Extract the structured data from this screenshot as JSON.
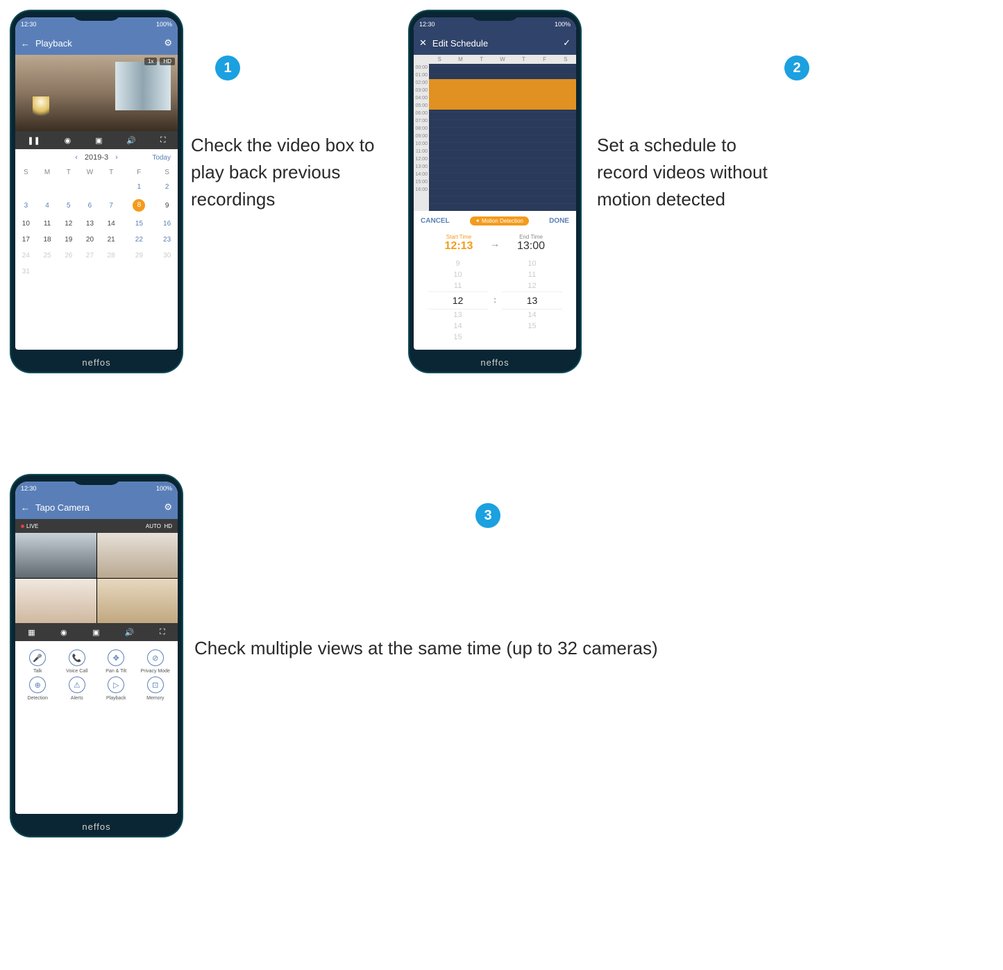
{
  "badges": {
    "one": "1",
    "two": "2",
    "three": "3"
  },
  "captions": {
    "one": "Check the video box to play back previous recordings",
    "two": "Set a schedule to record videos without motion detected",
    "three": "Check multiple views at the same time (up to 32 cameras)"
  },
  "phone_brand": "neffos",
  "status": {
    "time": "12:30",
    "right": "100%"
  },
  "playback": {
    "title": "Playback",
    "badges": {
      "speed": "1x",
      "quality": "HD"
    },
    "calendar": {
      "month": "2019-3",
      "today": "Today",
      "days": [
        "S",
        "M",
        "T",
        "W",
        "T",
        "F",
        "S"
      ],
      "rows": [
        [
          "",
          "",
          "",
          "",
          "",
          "1",
          "2"
        ],
        [
          "3",
          "4",
          "5",
          "6",
          "7",
          "8",
          "9"
        ],
        [
          "10",
          "11",
          "12",
          "13",
          "14",
          "15",
          "16"
        ],
        [
          "17",
          "18",
          "19",
          "20",
          "21",
          "22",
          "23"
        ],
        [
          "24",
          "25",
          "26",
          "27",
          "28",
          "29",
          "30"
        ],
        [
          "31",
          "",
          "",
          "",
          "",
          "",
          ""
        ]
      ],
      "selected": "8"
    }
  },
  "schedule": {
    "title": "Edit Schedule",
    "days": [
      "S",
      "M",
      "T",
      "W",
      "T",
      "F",
      "S"
    ],
    "hours": [
      "00:00",
      "01:00",
      "02:00",
      "03:00",
      "04:00",
      "05:00",
      "06:00",
      "07:00",
      "08:00",
      "09:00",
      "10:00",
      "11:00",
      "12:00",
      "13:00",
      "14:00",
      "15:00",
      "16:00"
    ],
    "cancel": "CANCEL",
    "done": "DONE",
    "mode": "Motion Detection",
    "start_label": "Start Time",
    "start_value": "12:13",
    "end_label": "End Time",
    "end_value": "13:00",
    "picker_left": [
      "9",
      "10",
      "11",
      "12",
      "13",
      "14",
      "15"
    ],
    "picker_right": [
      "10",
      "11",
      "12",
      "13",
      "14",
      "15"
    ],
    "picker_sel_left": "12",
    "picker_sel_right": "13"
  },
  "tapo": {
    "title": "Tapo Camera",
    "live": "LIVE",
    "auto": "AUTO",
    "hd": "HD",
    "features": [
      {
        "icon": "🎤",
        "label": "Talk"
      },
      {
        "icon": "📞",
        "label": "Voice Call"
      },
      {
        "icon": "✥",
        "label": "Pan & Tilt"
      },
      {
        "icon": "⊘",
        "label": "Privacy Mode"
      },
      {
        "icon": "⊕",
        "label": "Detection"
      },
      {
        "icon": "⚠",
        "label": "Alerts"
      },
      {
        "icon": "▷",
        "label": "Playback"
      },
      {
        "icon": "⊡",
        "label": "Memory"
      }
    ]
  }
}
